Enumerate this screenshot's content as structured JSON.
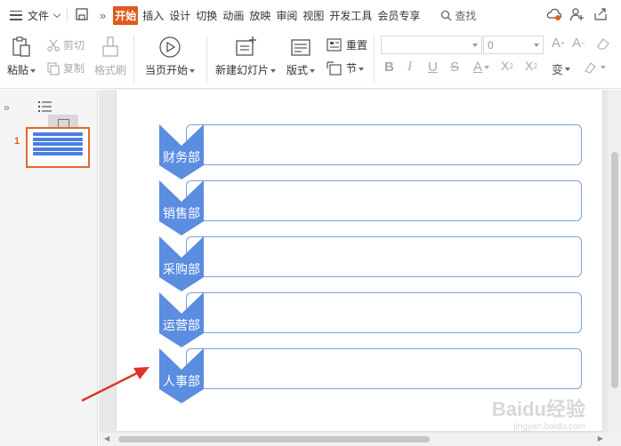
{
  "menubar": {
    "file_label": "文件",
    "tabs": [
      "开始",
      "插入",
      "设计",
      "切换",
      "动画",
      "放映",
      "审阅",
      "视图",
      "开发工具",
      "会员专享"
    ],
    "active_tab": "开始",
    "search_label": "查找"
  },
  "ribbon": {
    "paste": "粘贴",
    "cut": "剪切",
    "copy": "复制",
    "format_painter": "格式刷",
    "play_from_current": "当页开始",
    "new_slide": "新建幻灯片",
    "layout": "版式",
    "reset": "重置",
    "section": "节",
    "font_size_value": "0",
    "font_name_value": ""
  },
  "slides_panel": {
    "slide_number": "1"
  },
  "slide": {
    "rows": [
      {
        "label": "财务部"
      },
      {
        "label": "销售部"
      },
      {
        "label": "采购部"
      },
      {
        "label": "运营部"
      },
      {
        "label": "人事部"
      }
    ]
  },
  "colors": {
    "accent": "#e05a1c",
    "chevron_fill": "#5b8de0",
    "box_border": "#7aa0e0",
    "arrow_annotation": "#e0322a"
  },
  "watermark": {
    "brand": "Baidu经验",
    "url": "jingyan.baidu.com"
  }
}
